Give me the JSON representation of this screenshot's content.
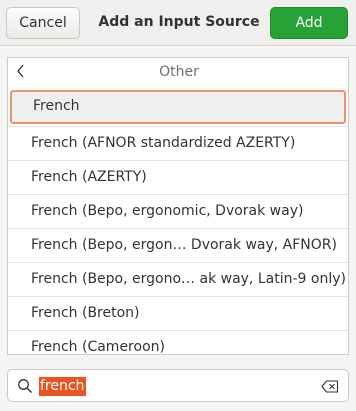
{
  "header": {
    "cancel_label": "Cancel",
    "title": "Add an Input Source",
    "add_label": "Add"
  },
  "list": {
    "back_icon": "chevron-left-icon",
    "header_label": "Other",
    "items": [
      {
        "label": "French",
        "selected": true
      },
      {
        "label": "French (AFNOR standardized AZERTY)"
      },
      {
        "label": "French (AZERTY)"
      },
      {
        "label": "French (Bepo, ergonomic, Dvorak way)"
      },
      {
        "label": "French (Bepo, ergon…  Dvorak way, AFNOR)"
      },
      {
        "label": "French (Bepo, ergono… ak way, Latin-9 only)"
      },
      {
        "label": "French (Breton)"
      },
      {
        "label": "French (Cameroon)"
      }
    ]
  },
  "search": {
    "value": "french",
    "icon": "search-icon",
    "clear_icon": "clear-text-icon"
  },
  "colors": {
    "add_button": "#26a236",
    "selection_border": "#e9946a",
    "search_highlight": "#e95420"
  }
}
